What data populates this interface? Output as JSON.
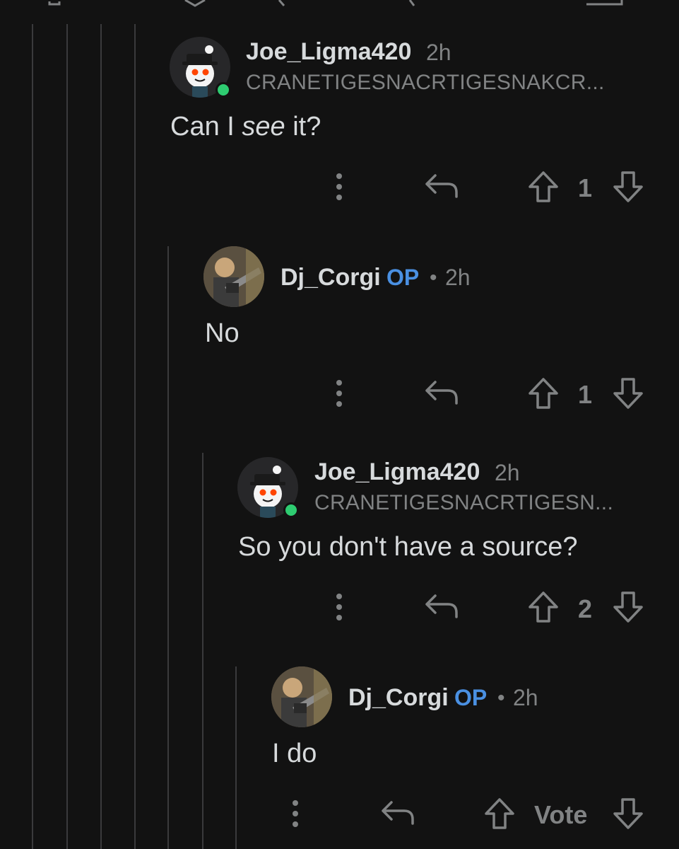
{
  "comments": [
    {
      "username": "Joe_Ligma420",
      "time": "2h",
      "flair": "CRANETIGESNACRTIGESNAKCR...",
      "body_pre": "Can I ",
      "body_em": "see",
      "body_post": " it?",
      "score": "1"
    },
    {
      "username": "Dj_Corgi",
      "op_badge": "OP",
      "separator": "•",
      "time": "2h",
      "body": "No",
      "score": "1"
    },
    {
      "username": "Joe_Ligma420",
      "time": "2h",
      "flair": "CRANETIGESNACRTIGESN...",
      "body": "So you don't have a source?",
      "score": "2"
    },
    {
      "username": "Dj_Corgi",
      "op_badge": "OP",
      "separator": "•",
      "time": "2h",
      "body": "I do",
      "score": "Vote"
    }
  ],
  "icons": {
    "more": "more-vertical-icon",
    "reply": "reply-arrow-icon",
    "upvote": "upvote-arrow-icon",
    "downvote": "downvote-arrow-icon",
    "avatar_joe": "snoo-fedora-avatar",
    "avatar_corgi": "photo-avatar"
  },
  "colors": {
    "background": "#121212",
    "text": "#d7dadc",
    "muted": "#818384",
    "op_blue": "#4a90e2",
    "online_green": "#2ecc71",
    "thread_line": "#3a3a3c"
  }
}
